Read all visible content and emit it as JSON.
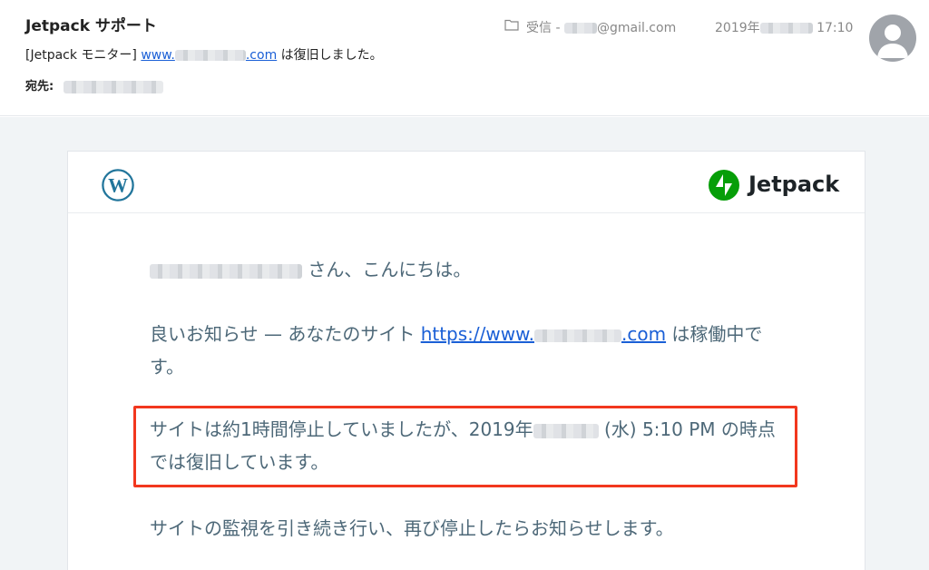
{
  "mail": {
    "sender": "Jetpack サポート",
    "subject_prefix": "[Jetpack モニター]",
    "subject_link_start": "www.",
    "subject_link_end": ".com",
    "subject_suffix": "は復旧しました。",
    "to_label": "宛先:",
    "folder_prefix": "受信 -",
    "folder_email": "@gmail.com",
    "date_prefix": "2019年",
    "time": "17:10"
  },
  "icons": {
    "folder": "folder-icon",
    "avatar": "avatar-icon",
    "wordpress": "wordpress-logo",
    "jetpack": "jetpack-logo"
  },
  "brand": {
    "jetpack_name": "Jetpack",
    "jetpack_color": "#069e08",
    "wordpress_color": "#21759b",
    "highlight_color": "#f2371e"
  },
  "content": {
    "greeting_suffix": "さん、こんにちは。",
    "p2_prefix": "良いお知らせ — あなたのサイト",
    "site_link_start": "https://www.",
    "site_link_end": ".com",
    "p2_suffix": "は稼働中です。",
    "p3_prefix": "サイトは約1時間停止していましたが、2019年",
    "p3_suffix": "(水) 5:10 PM の時点では復旧しています。",
    "p4": "サイトの監視を引き続き行い、再び停止したらお知らせします。"
  }
}
